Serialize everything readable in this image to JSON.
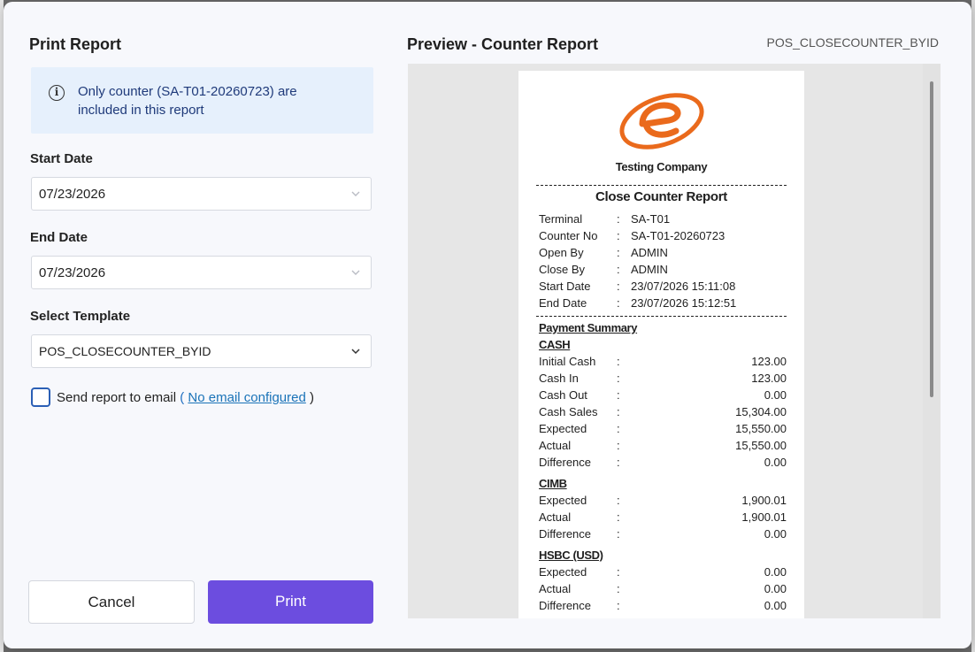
{
  "left": {
    "title": "Print Report",
    "info_text": "Only counter (SA-T01-20260723) are included in this report",
    "start_date_label": "Start Date",
    "start_date_value": "07/23/2026",
    "end_date_label": "End Date",
    "end_date_value": "07/23/2026",
    "template_label": "Select Template",
    "template_value": "POS_CLOSECOUNTER_BYID",
    "email_label": "Send report to email",
    "email_paren_open": "(",
    "email_link": "No email configured",
    "email_paren_close": ")",
    "email_checked": false,
    "cancel_label": "Cancel",
    "print_label": "Print"
  },
  "preview": {
    "title": "Preview - Counter Report",
    "template_code": "POS_CLOSECOUNTER_BYID"
  },
  "report": {
    "company": "Testing Company",
    "title": "Close Counter Report",
    "details": [
      {
        "label": "Terminal",
        "value": "SA-T01"
      },
      {
        "label": "Counter No",
        "value": "SA-T01-20260723"
      },
      {
        "label": "Open By",
        "value": "ADMIN"
      },
      {
        "label": "Close By",
        "value": "ADMIN"
      },
      {
        "label": "Start Date",
        "value": "23/07/2026 15:11:08"
      },
      {
        "label": "End Date",
        "value": "23/07/2026 15:12:51"
      }
    ],
    "payment_summary_heading": "Payment Summary",
    "sections": [
      {
        "name": "CASH",
        "rows": [
          {
            "label": "Initial Cash",
            "value": "123.00"
          },
          {
            "label": "Cash In",
            "value": "123.00"
          },
          {
            "label": "Cash Out",
            "value": "0.00"
          },
          {
            "label": "Cash Sales",
            "value": "15,304.00"
          },
          {
            "label": "Expected",
            "value": "15,550.00"
          },
          {
            "label": "Actual",
            "value": "15,550.00"
          },
          {
            "label": "Difference",
            "value": "0.00"
          }
        ]
      },
      {
        "name": "CIMB",
        "rows": [
          {
            "label": "Expected",
            "value": "1,900.01"
          },
          {
            "label": "Actual",
            "value": "1,900.01"
          },
          {
            "label": "Difference",
            "value": "0.00"
          }
        ]
      },
      {
        "name": "HSBC (USD)",
        "rows": [
          {
            "label": "Expected",
            "value": "0.00"
          },
          {
            "label": "Actual",
            "value": "0.00"
          },
          {
            "label": "Difference",
            "value": "0.00"
          }
        ]
      }
    ]
  },
  "colors": {
    "accent": "#6c4ddf",
    "info_bg": "#e6f0fc",
    "link": "#1a73b8",
    "logo": "#ea6a1c"
  },
  "icons": [
    "info-icon",
    "chevron-down-icon",
    "company-logo"
  ]
}
